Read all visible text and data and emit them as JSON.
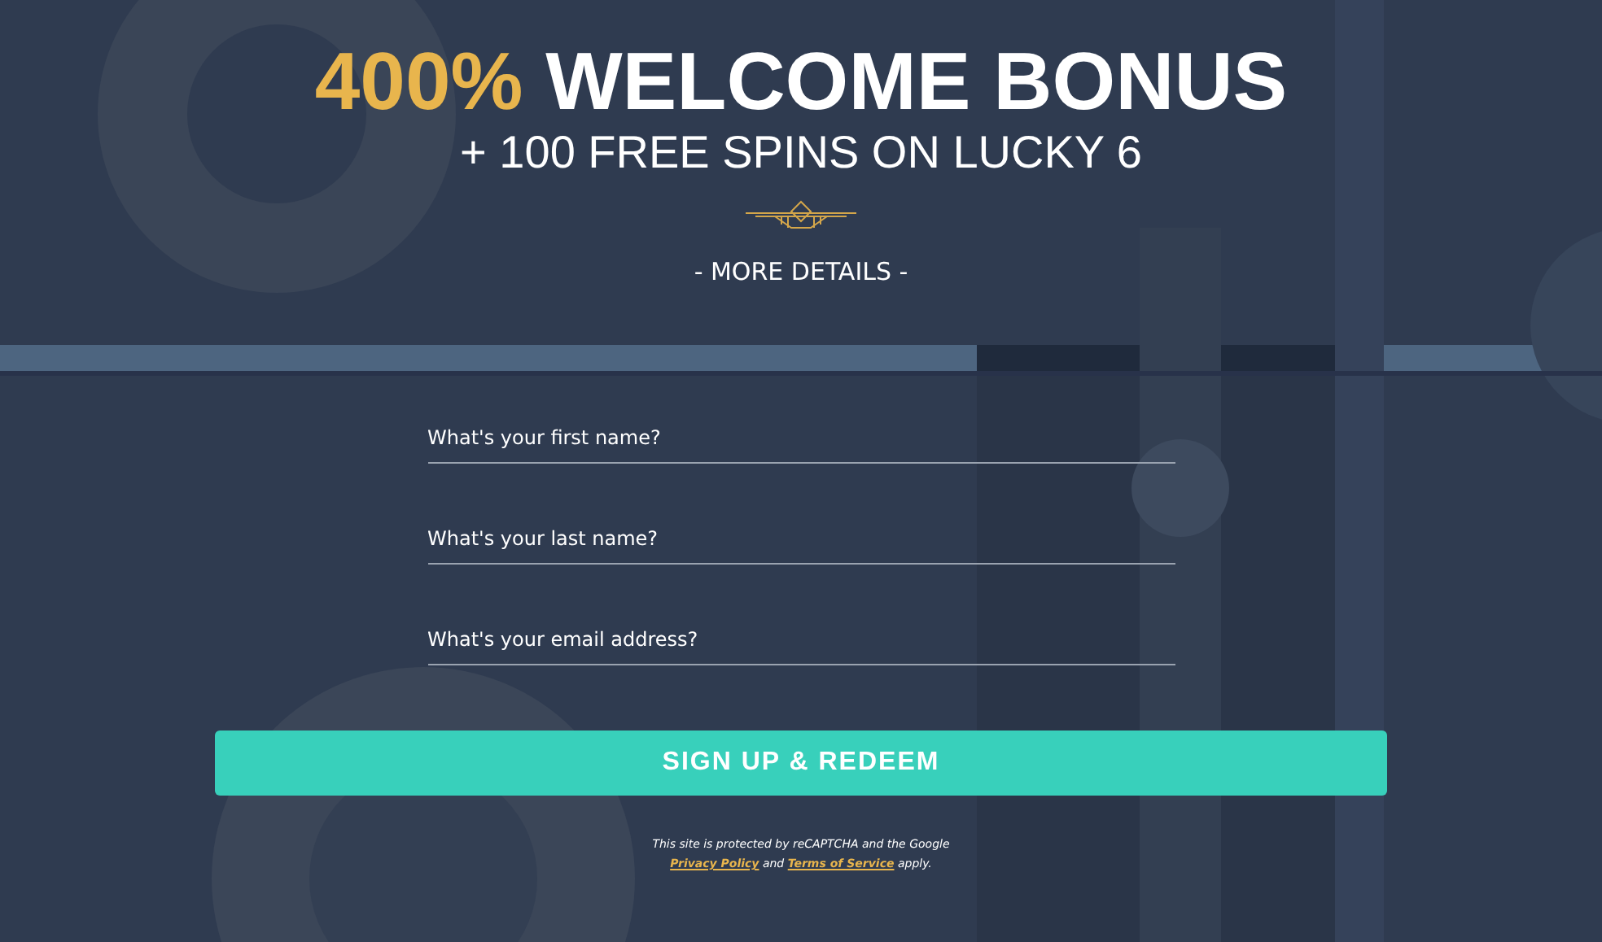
{
  "headline": {
    "highlight": "400%",
    "rest": "WELCOME BONUS"
  },
  "subheadline": "+ 100 FREE SPINS ON LUCKY 6",
  "more_details": "- MORE DETAILS -",
  "fields": [
    {
      "placeholder": "What's your first name?"
    },
    {
      "placeholder": "What's your last name?"
    },
    {
      "placeholder": "What's your email address?"
    }
  ],
  "submit": "SIGN UP & REDEEM",
  "notice": {
    "before": "This site is protected by reCAPTCHA and the Google",
    "privacy_link": "Privacy Policy",
    "middle": "and",
    "terms_link": "Terms of Service",
    "after": "apply."
  }
}
